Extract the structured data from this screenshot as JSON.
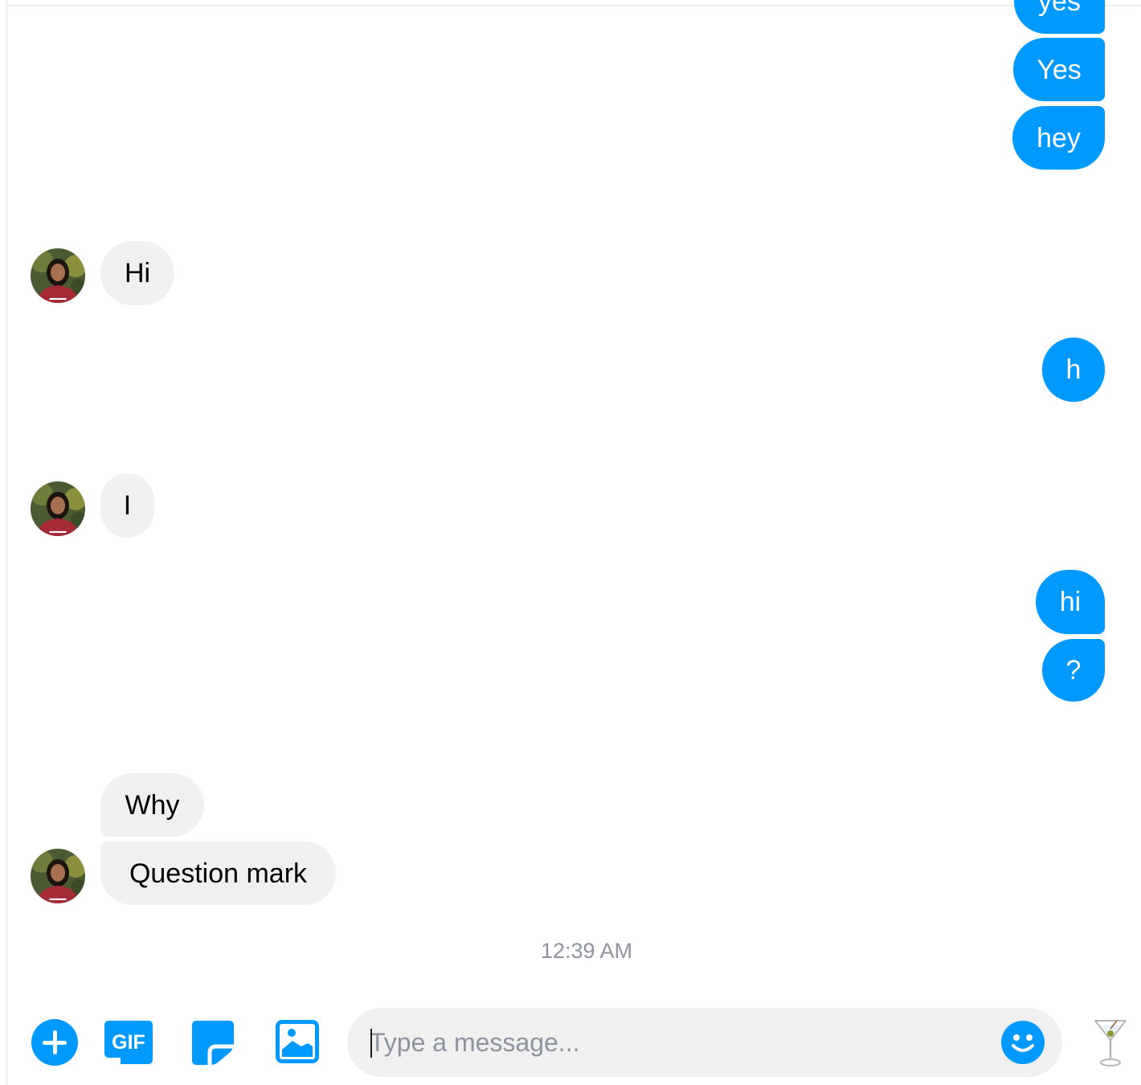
{
  "conversation": {
    "messages": [
      {
        "direction": "outgoing",
        "text": "yes"
      },
      {
        "direction": "outgoing",
        "text": "Yes"
      },
      {
        "direction": "outgoing",
        "text": "hey"
      },
      {
        "direction": "incoming",
        "text": "Hi"
      },
      {
        "direction": "outgoing",
        "text": "h"
      },
      {
        "direction": "incoming",
        "text": "I"
      },
      {
        "direction": "outgoing",
        "text": "hi"
      },
      {
        "direction": "outgoing",
        "text": "?"
      },
      {
        "direction": "incoming",
        "text": "Why"
      },
      {
        "direction": "incoming",
        "text": "Question mark"
      }
    ],
    "timestamp": "12:39 AM"
  },
  "composer": {
    "placeholder": "Type a message...",
    "value": "",
    "actions": [
      "plus-icon",
      "gif-icon",
      "sticker-icon",
      "photo-icon",
      "emoji-icon",
      "martini-icon"
    ],
    "gif_label": "GIF"
  },
  "colors": {
    "outgoing_bubble": "#0099ff",
    "incoming_bubble": "#f1f0f0",
    "accent": "#0099ff",
    "timestamp": "#8d949e"
  }
}
